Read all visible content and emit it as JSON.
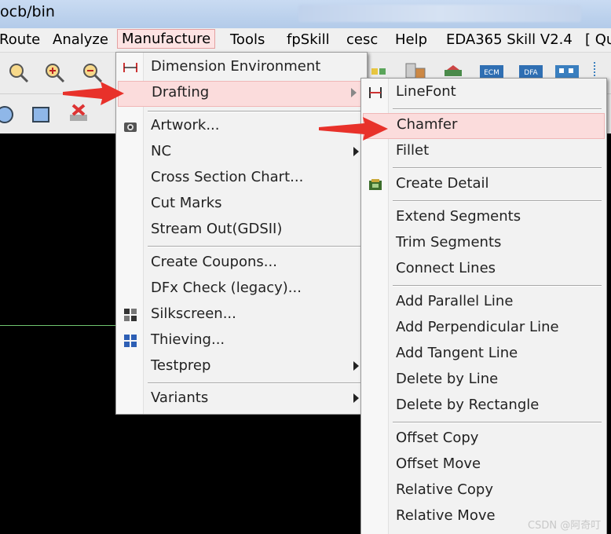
{
  "window": {
    "title": "ocb/bin"
  },
  "menubar": {
    "items": [
      "Route",
      "Analyze",
      "Manufacture",
      "Tools",
      "fpSkill",
      "cesc",
      "Help",
      "EDA365 Skill V2.4",
      "[ Qu"
    ],
    "active": "Manufacture"
  },
  "manufacture_menu": {
    "items": [
      {
        "label": "Dimension Environment",
        "icon": "dimension-icon"
      },
      {
        "label": "Drafting",
        "submenu": true,
        "highlighted": true
      },
      {
        "label": "Artwork...",
        "icon": "camera-icon"
      },
      {
        "label": "NC",
        "submenu": true
      },
      {
        "label": "Cross Section Chart..."
      },
      {
        "label": "Cut Marks"
      },
      {
        "label": "Stream Out(GDSII)"
      },
      {
        "label": "Create Coupons..."
      },
      {
        "label": "DFx Check (legacy)..."
      },
      {
        "label": "Silkscreen...",
        "icon": "silkscreen-icon"
      },
      {
        "label": "Thieving...",
        "icon": "thieving-icon"
      },
      {
        "label": "Testprep",
        "submenu": true
      },
      {
        "label": "Variants",
        "submenu": true
      }
    ]
  },
  "drafting_menu": {
    "items": [
      {
        "label": "LineFont",
        "icon": "linefont-icon"
      },
      {
        "label": "Chamfer",
        "highlighted": true
      },
      {
        "label": "Fillet"
      },
      {
        "label": "Create Detail",
        "icon": "detail-icon"
      },
      {
        "label": "Extend Segments"
      },
      {
        "label": "Trim Segments"
      },
      {
        "label": "Connect Lines"
      },
      {
        "label": "Add Parallel Line"
      },
      {
        "label": "Add Perpendicular Line"
      },
      {
        "label": "Add Tangent Line"
      },
      {
        "label": "Delete by Line"
      },
      {
        "label": "Delete by Rectangle"
      },
      {
        "label": "Offset Copy"
      },
      {
        "label": "Offset Move"
      },
      {
        "label": "Relative Copy"
      },
      {
        "label": "Relative Move"
      }
    ]
  },
  "watermark": "CSDN @阿奇叮",
  "colors": {
    "highlight": "#fbdcdc",
    "arrow": "#e8312a",
    "menubg": "#f2f2f2"
  }
}
